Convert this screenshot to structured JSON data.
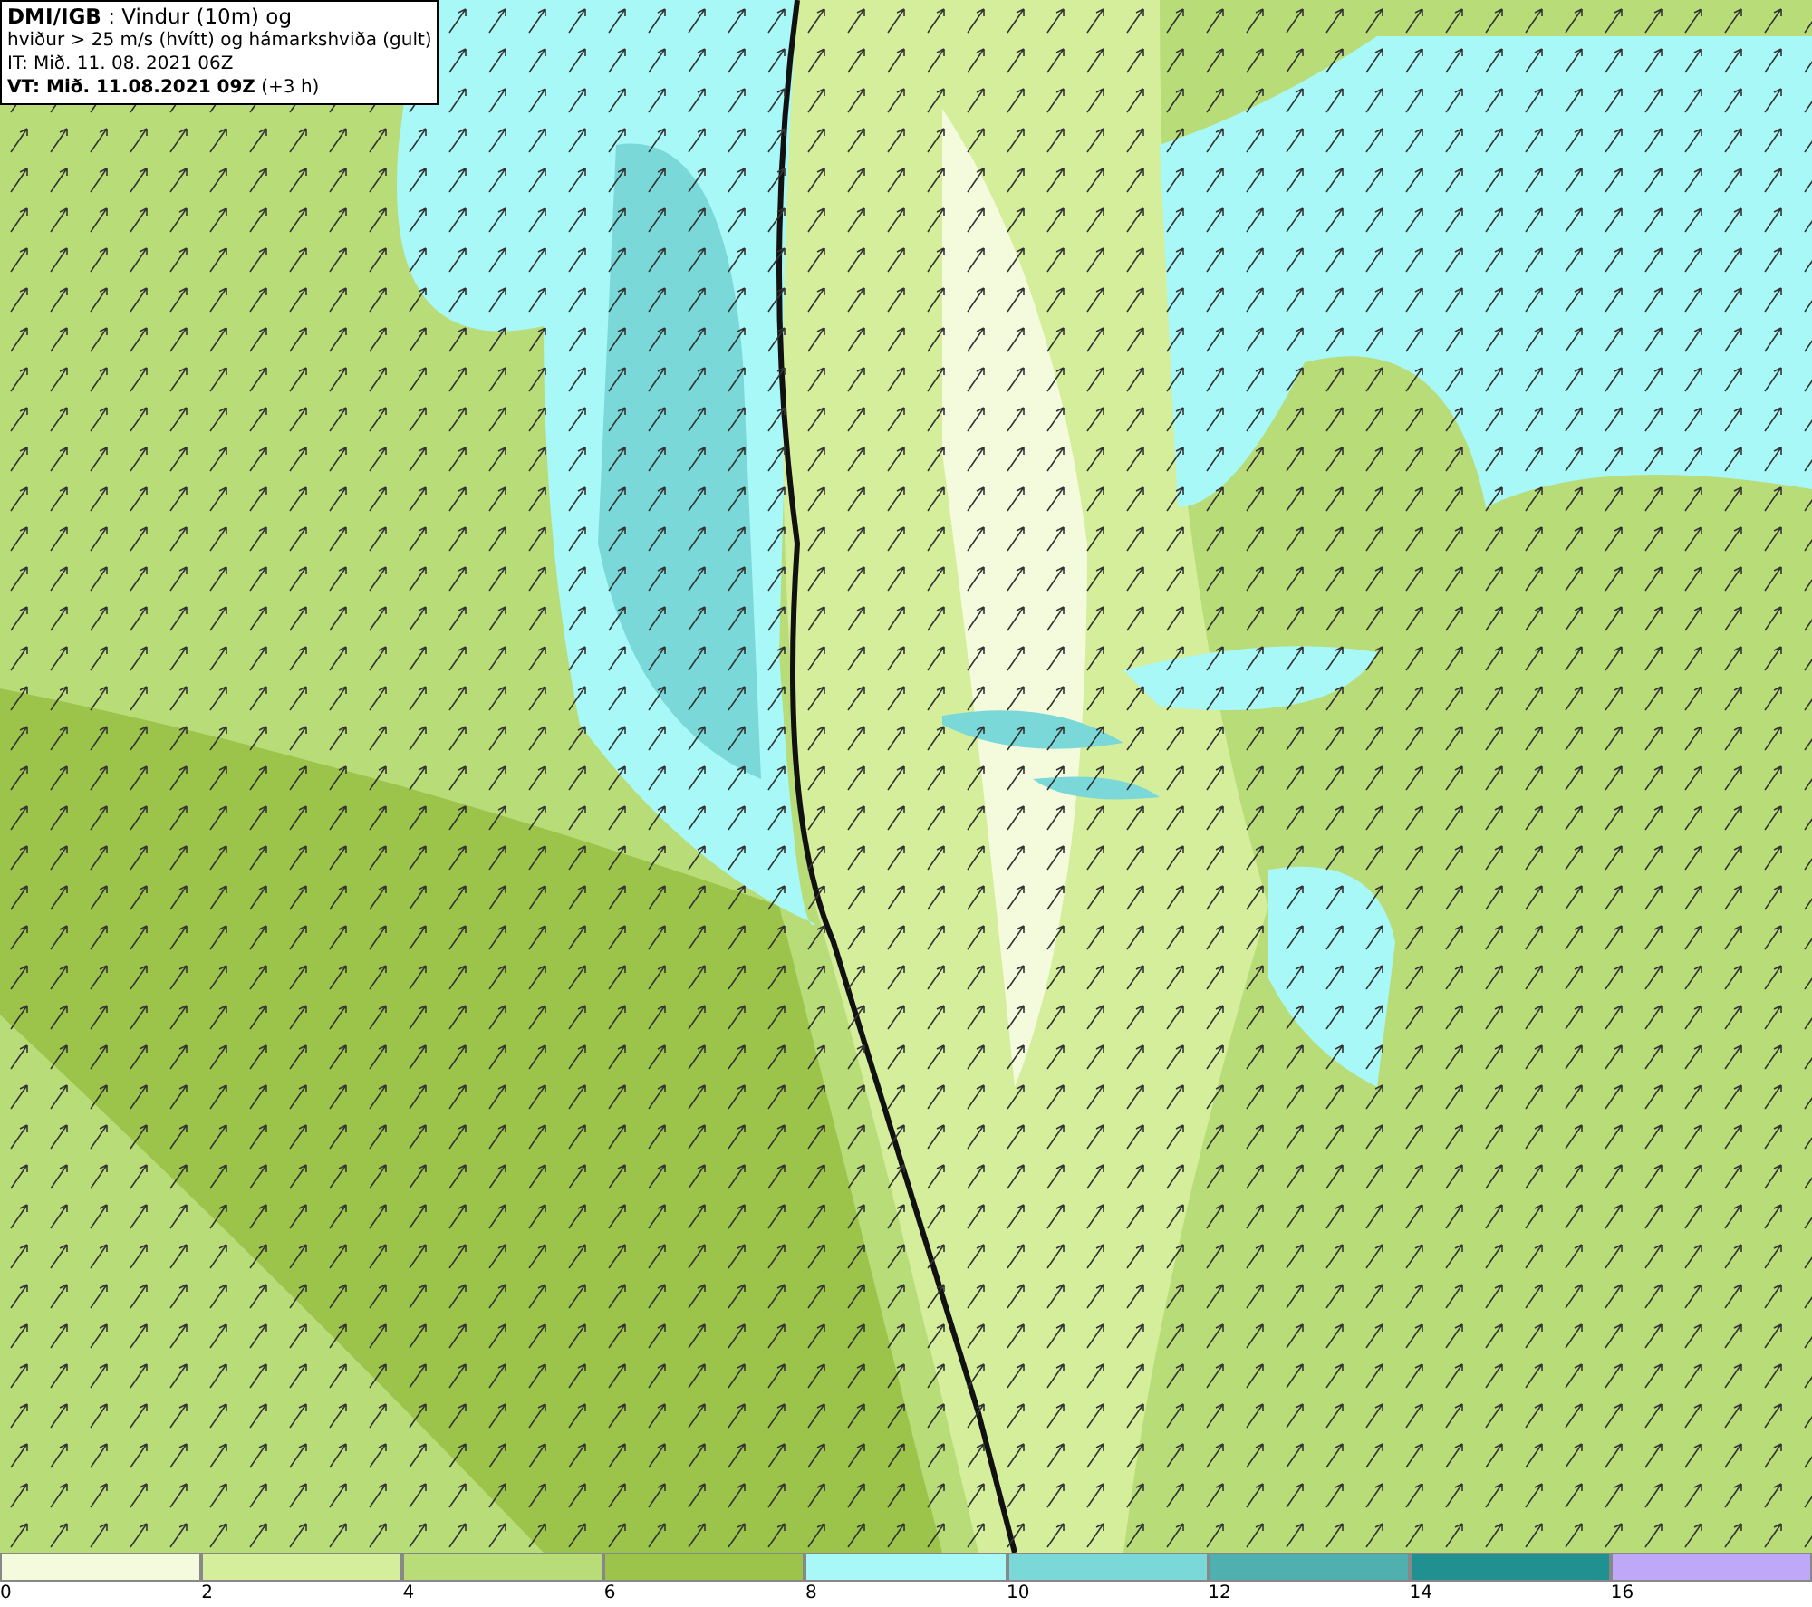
{
  "header": {
    "lines": [
      "**DMI/IGB** : Vindur (10m) og",
      "hviður > 25 m/s (hvítt) og hámarkshviða (gult)",
      "IT: Mið. 11. 08. 2021 06Z",
      "**VT: Mið. 11.08.2021 09Z** (+3 h)"
    ]
  },
  "legend": {
    "bins": [
      {
        "label": "0",
        "color": "#f4fbdc"
      },
      {
        "label": "2",
        "color": "#d4ee9c"
      },
      {
        "label": "4",
        "color": "#b8dc78"
      },
      {
        "label": "6",
        "color": "#9cc44a"
      },
      {
        "label": "8",
        "color": "#a8f8f8"
      },
      {
        "label": "10",
        "color": "#7ad8d8"
      },
      {
        "label": "12",
        "color": "#50b0b0"
      },
      {
        "label": "14",
        "color": "#209090"
      },
      {
        "label": "16",
        "color": "#c0a8f8"
      }
    ]
  }
}
